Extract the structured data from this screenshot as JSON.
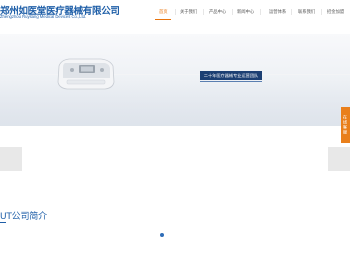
{
  "header": {
    "logo_cn": "郑州如医堂医疗器械有限公司",
    "logo_en": "Zhengzhou Ruyitang Medical Devices Co.,Ltd."
  },
  "nav": {
    "items": [
      {
        "label": "首页",
        "active": true
      },
      {
        "label": "关于我们",
        "active": false
      },
      {
        "label": "产品中心",
        "active": false
      },
      {
        "label": "新闻中心",
        "active": false
      },
      {
        "label": "运营体系",
        "active": false
      },
      {
        "label": "联系我们",
        "active": false
      },
      {
        "label": "招金加盟",
        "active": false
      }
    ],
    "accent_color": "#e8730c"
  },
  "hero": {
    "tagline": "二十年医疗器械专业运营团队"
  },
  "side_tab": {
    "label": "在线客服"
  },
  "about": {
    "title": "UT公司简介"
  },
  "colors": {
    "brand_blue": "#1f5fa8",
    "tag_navy": "#1c3f73",
    "side_orange": "#e97f1b"
  }
}
